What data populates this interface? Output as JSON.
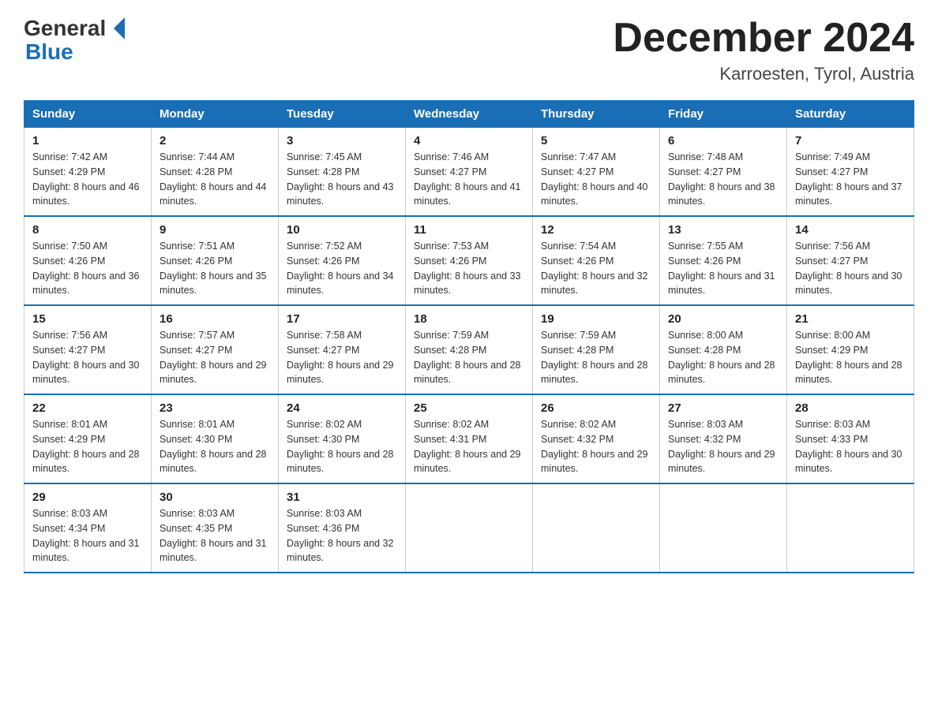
{
  "header": {
    "title": "December 2024",
    "subtitle": "Karroesten, Tyrol, Austria",
    "logo_general": "General",
    "logo_blue": "Blue"
  },
  "days_of_week": [
    "Sunday",
    "Monday",
    "Tuesday",
    "Wednesday",
    "Thursday",
    "Friday",
    "Saturday"
  ],
  "weeks": [
    [
      {
        "day": "1",
        "sunrise": "7:42 AM",
        "sunset": "4:29 PM",
        "daylight": "8 hours and 46 minutes."
      },
      {
        "day": "2",
        "sunrise": "7:44 AM",
        "sunset": "4:28 PM",
        "daylight": "8 hours and 44 minutes."
      },
      {
        "day": "3",
        "sunrise": "7:45 AM",
        "sunset": "4:28 PM",
        "daylight": "8 hours and 43 minutes."
      },
      {
        "day": "4",
        "sunrise": "7:46 AM",
        "sunset": "4:27 PM",
        "daylight": "8 hours and 41 minutes."
      },
      {
        "day": "5",
        "sunrise": "7:47 AM",
        "sunset": "4:27 PM",
        "daylight": "8 hours and 40 minutes."
      },
      {
        "day": "6",
        "sunrise": "7:48 AM",
        "sunset": "4:27 PM",
        "daylight": "8 hours and 38 minutes."
      },
      {
        "day": "7",
        "sunrise": "7:49 AM",
        "sunset": "4:27 PM",
        "daylight": "8 hours and 37 minutes."
      }
    ],
    [
      {
        "day": "8",
        "sunrise": "7:50 AM",
        "sunset": "4:26 PM",
        "daylight": "8 hours and 36 minutes."
      },
      {
        "day": "9",
        "sunrise": "7:51 AM",
        "sunset": "4:26 PM",
        "daylight": "8 hours and 35 minutes."
      },
      {
        "day": "10",
        "sunrise": "7:52 AM",
        "sunset": "4:26 PM",
        "daylight": "8 hours and 34 minutes."
      },
      {
        "day": "11",
        "sunrise": "7:53 AM",
        "sunset": "4:26 PM",
        "daylight": "8 hours and 33 minutes."
      },
      {
        "day": "12",
        "sunrise": "7:54 AM",
        "sunset": "4:26 PM",
        "daylight": "8 hours and 32 minutes."
      },
      {
        "day": "13",
        "sunrise": "7:55 AM",
        "sunset": "4:26 PM",
        "daylight": "8 hours and 31 minutes."
      },
      {
        "day": "14",
        "sunrise": "7:56 AM",
        "sunset": "4:27 PM",
        "daylight": "8 hours and 30 minutes."
      }
    ],
    [
      {
        "day": "15",
        "sunrise": "7:56 AM",
        "sunset": "4:27 PM",
        "daylight": "8 hours and 30 minutes."
      },
      {
        "day": "16",
        "sunrise": "7:57 AM",
        "sunset": "4:27 PM",
        "daylight": "8 hours and 29 minutes."
      },
      {
        "day": "17",
        "sunrise": "7:58 AM",
        "sunset": "4:27 PM",
        "daylight": "8 hours and 29 minutes."
      },
      {
        "day": "18",
        "sunrise": "7:59 AM",
        "sunset": "4:28 PM",
        "daylight": "8 hours and 28 minutes."
      },
      {
        "day": "19",
        "sunrise": "7:59 AM",
        "sunset": "4:28 PM",
        "daylight": "8 hours and 28 minutes."
      },
      {
        "day": "20",
        "sunrise": "8:00 AM",
        "sunset": "4:28 PM",
        "daylight": "8 hours and 28 minutes."
      },
      {
        "day": "21",
        "sunrise": "8:00 AM",
        "sunset": "4:29 PM",
        "daylight": "8 hours and 28 minutes."
      }
    ],
    [
      {
        "day": "22",
        "sunrise": "8:01 AM",
        "sunset": "4:29 PM",
        "daylight": "8 hours and 28 minutes."
      },
      {
        "day": "23",
        "sunrise": "8:01 AM",
        "sunset": "4:30 PM",
        "daylight": "8 hours and 28 minutes."
      },
      {
        "day": "24",
        "sunrise": "8:02 AM",
        "sunset": "4:30 PM",
        "daylight": "8 hours and 28 minutes."
      },
      {
        "day": "25",
        "sunrise": "8:02 AM",
        "sunset": "4:31 PM",
        "daylight": "8 hours and 29 minutes."
      },
      {
        "day": "26",
        "sunrise": "8:02 AM",
        "sunset": "4:32 PM",
        "daylight": "8 hours and 29 minutes."
      },
      {
        "day": "27",
        "sunrise": "8:03 AM",
        "sunset": "4:32 PM",
        "daylight": "8 hours and 29 minutes."
      },
      {
        "day": "28",
        "sunrise": "8:03 AM",
        "sunset": "4:33 PM",
        "daylight": "8 hours and 30 minutes."
      }
    ],
    [
      {
        "day": "29",
        "sunrise": "8:03 AM",
        "sunset": "4:34 PM",
        "daylight": "8 hours and 31 minutes."
      },
      {
        "day": "30",
        "sunrise": "8:03 AM",
        "sunset": "4:35 PM",
        "daylight": "8 hours and 31 minutes."
      },
      {
        "day": "31",
        "sunrise": "8:03 AM",
        "sunset": "4:36 PM",
        "daylight": "8 hours and 32 minutes."
      },
      null,
      null,
      null,
      null
    ]
  ]
}
